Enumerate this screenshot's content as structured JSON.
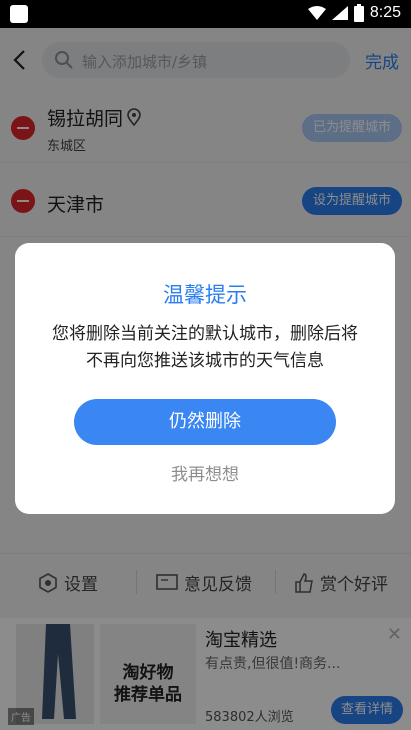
{
  "status_bar": {
    "time": "8:25"
  },
  "topbar": {
    "search_placeholder": "输入添加城市/乡镇",
    "done_label": "完成"
  },
  "cities": [
    {
      "name": "锡拉胡同",
      "district": "东城区",
      "action": "已为提醒城市",
      "pill_color": "#a9c9f6",
      "has_location_icon": true
    },
    {
      "name": "天津市",
      "district": "",
      "action": "设为提醒城市",
      "pill_color": "#2a7ef0",
      "has_location_icon": false
    }
  ],
  "bottom_tools": {
    "settings": "设置",
    "feedback": "意见反馈",
    "rate": "赏个好评"
  },
  "ad": {
    "title": "淘宝精选",
    "subtitle": "有点贵,但很值!商务...",
    "views": "583802人浏览",
    "button": "查看详情",
    "tag": "广告",
    "image_text_line1": "淘好物",
    "image_text_line2": "推荐单品"
  },
  "dialog": {
    "title": "温馨提示",
    "message": "您将删除当前关注的默认城市，删除后将不再向您推送该城市的天气信息",
    "confirm": "仍然删除",
    "cancel": "我再想想"
  },
  "colors": {
    "accent": "#2a7ef0",
    "danger": "#e0252b"
  }
}
